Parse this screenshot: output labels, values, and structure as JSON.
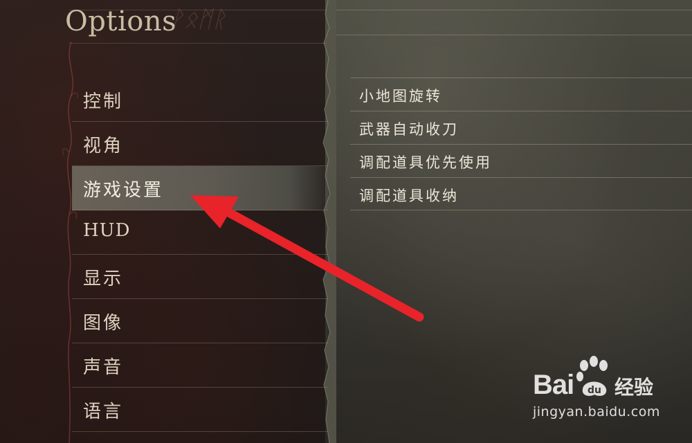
{
  "header": {
    "title": "Options"
  },
  "menu": {
    "items": [
      {
        "label": "控制"
      },
      {
        "label": "视角"
      },
      {
        "label": "游戏设置",
        "selected": true
      },
      {
        "label": "HUD"
      },
      {
        "label": "显示"
      },
      {
        "label": "图像"
      },
      {
        "label": "声音"
      },
      {
        "label": "语言"
      }
    ]
  },
  "submenu": {
    "items": [
      {
        "label": "小地图旋转"
      },
      {
        "label": "武器自动收刀"
      },
      {
        "label": "调配道具优先使用"
      },
      {
        "label": "调配道具收纳"
      }
    ]
  },
  "annotation": {
    "arrow_color": "#e8232a",
    "points_to": "游戏设置"
  },
  "watermark": {
    "logo_left": "Bai",
    "logo_right": "经验",
    "url": "jingyan.baidu.com"
  },
  "colors": {
    "text": "#ddd3c0",
    "title": "#c9bca4",
    "selected_bg": "#8f968a",
    "arrow": "#e8232a"
  }
}
